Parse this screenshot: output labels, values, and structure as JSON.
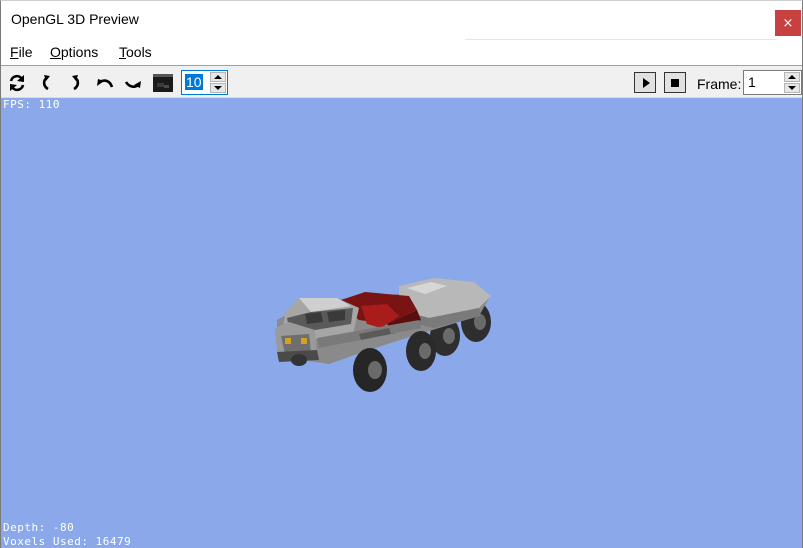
{
  "window": {
    "title": "OpenGL 3D Preview",
    "close_glyph": "×"
  },
  "menu": {
    "items": [
      {
        "prefix": "",
        "underlined": "F",
        "rest": "ile"
      },
      {
        "prefix": "",
        "underlined": "O",
        "rest": "ptions"
      },
      {
        "prefix": "",
        "underlined": "T",
        "rest": "ools"
      }
    ]
  },
  "toolbar": {
    "icons": [
      "refresh-icon",
      "rotate-left-icon",
      "rotate-right-icon",
      "undo-icon",
      "redo-icon",
      "screenshot-icon"
    ],
    "step_value": "10",
    "frame_label": "Frame:",
    "frame_value": "1"
  },
  "viewport": {
    "fps": "FPS: 110",
    "depth": "Depth: -80",
    "voxels": "Voxels Used: 16479",
    "background_color": "#8aa8ea"
  },
  "colors": {
    "close_button": "#c94040",
    "accent_focus": "#0078d7"
  }
}
